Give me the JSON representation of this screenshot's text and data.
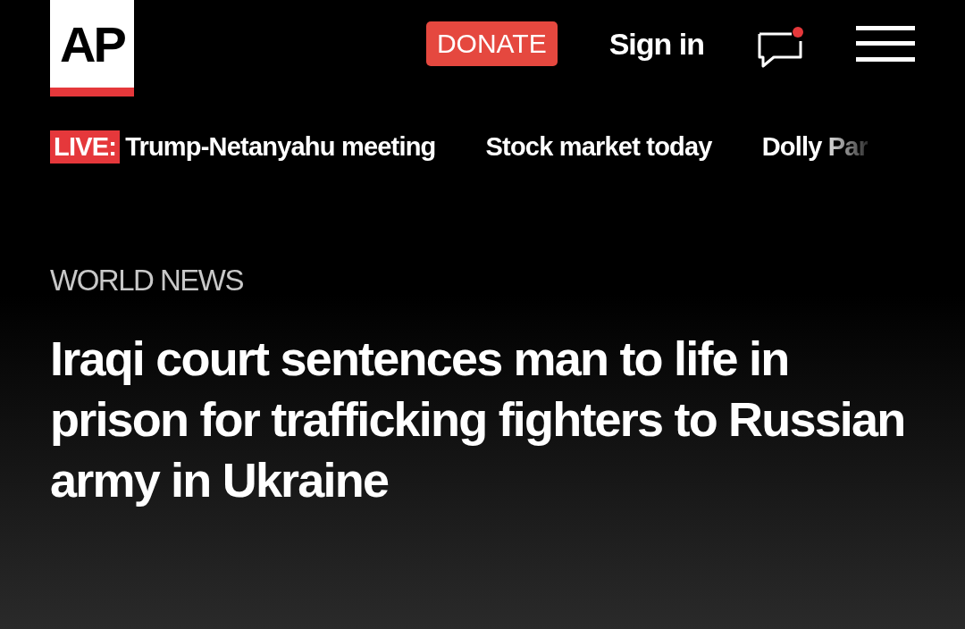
{
  "header": {
    "logo": "AP",
    "donate": "DONATE",
    "sign_in": "Sign in"
  },
  "trending": [
    {
      "live": true,
      "label": "Trump-Netanyahu meeting"
    },
    {
      "live": false,
      "label": "Stock market today"
    },
    {
      "live": false,
      "label": "Dolly Par"
    }
  ],
  "live_badge": "LIVE:",
  "section": "WORLD NEWS",
  "headline": "Iraqi court sentences man to life in prison for trafficking fighters to Russian army in Ukraine"
}
